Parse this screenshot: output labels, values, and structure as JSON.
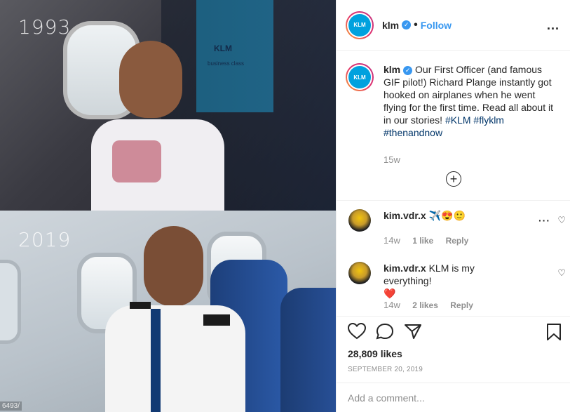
{
  "photo": {
    "year_top": "1993",
    "year_bottom": "2019",
    "corner_text": "6493/"
  },
  "header": {
    "username": "klm",
    "follow_label": "Follow",
    "more_label": "..."
  },
  "caption": {
    "username": "klm",
    "text": "Our First Officer (and famous GIF pilot!) Richard Plange instantly got hooked on airplanes when he went flying for the first time. Read all about it in our stories!",
    "tags": [
      "#KLM",
      "#flyklm",
      "#thenandnow"
    ],
    "age": "15w"
  },
  "comments": [
    {
      "username": "kim.vdr.x",
      "text": "✈️😍🙂",
      "age": "14w",
      "likes": "1 like",
      "reply": "Reply"
    },
    {
      "username": "kim.vdr.x",
      "text": "KLM is my everything!",
      "emoji": "❤️",
      "age": "14w",
      "likes": "2 likes",
      "reply": "Reply"
    }
  ],
  "stats": {
    "likes": "28,809 likes",
    "date": "SEPTEMBER 20, 2019"
  },
  "add_comment": {
    "placeholder": "Add a comment..."
  },
  "avatar_text": "KLM",
  "colors": {
    "accent": "#3897f0",
    "klm_blue": "#00a1de"
  }
}
